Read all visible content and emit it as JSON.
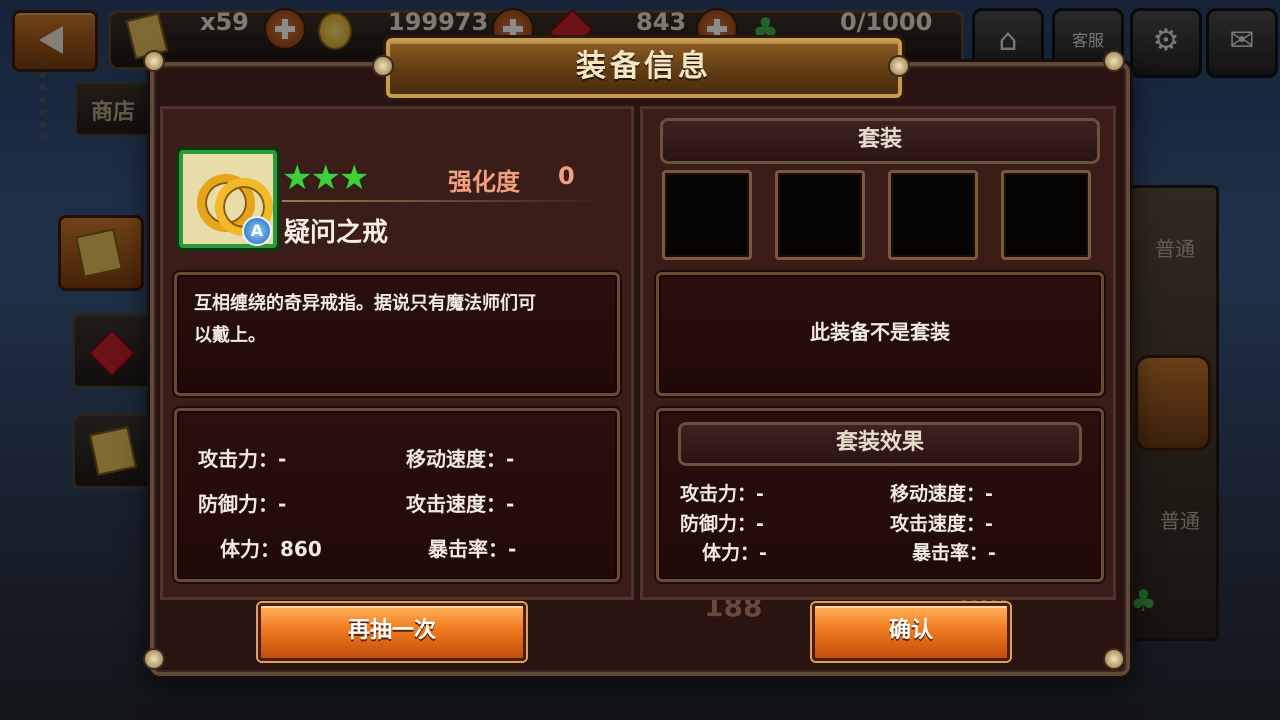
{
  "hud": {
    "ticket_count": "x59",
    "gold_partial": "199973",
    "gem_partial": "843",
    "clover_partial": "0/1000",
    "service_label": "客服"
  },
  "background": {
    "shop_tab_partial": "商店",
    "normal_label_1": "普通",
    "normal_label_2": "普通",
    "price_1": "188",
    "price_2": "380"
  },
  "dialog": {
    "title": "装备信息",
    "item": {
      "stars": "★★★",
      "enhance_label": "强化度",
      "enhance_value": "0",
      "grade": "A",
      "name": "疑问之戒",
      "description_line1": "互相缠绕的奇异戒指。据说只有魔法师们可",
      "description_line2": "以戴上。"
    },
    "stats": {
      "attack": "攻击力：-",
      "move_speed": "移动速度：-",
      "defense": "防御力：-",
      "attack_speed": "攻击速度：-",
      "hp": "体力：860",
      "crit_rate": "暴击率：-"
    },
    "set": {
      "header": "套装",
      "message": "此装备不是套装",
      "effect_header": "套装效果",
      "attack": "攻击力：-",
      "move_speed": "移动速度：-",
      "defense": "防御力：-",
      "attack_speed": "攻击速度：-",
      "hp": "体力：-",
      "crit_rate": "暴击率：-"
    },
    "buttons": {
      "redraw": "再抽一次",
      "confirm": "确认"
    }
  },
  "colors": {
    "accent_orange": "#f07a20",
    "enhance_text": "#f0a07c",
    "star_green": "#3fcf3a"
  },
  "icons": [
    "back-arrow-icon",
    "ticket-icon",
    "gold-coin-icon",
    "red-gem-icon",
    "clover-icon",
    "home-icon",
    "customer-service-icon",
    "gear-icon",
    "chat-bubble-icon",
    "ring-icon",
    "treasure-chest-icon"
  ]
}
